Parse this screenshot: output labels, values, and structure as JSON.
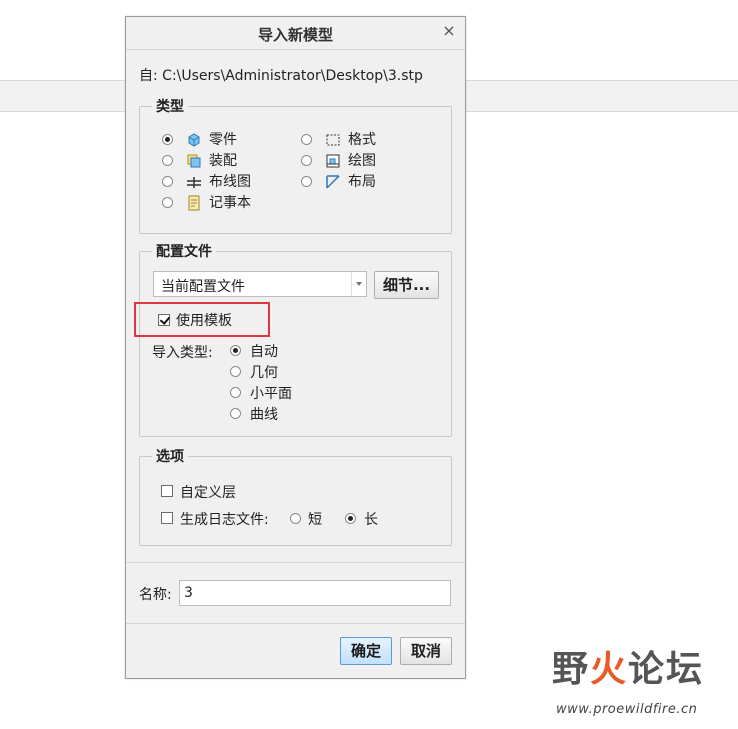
{
  "dialog": {
    "title": "导入新模型",
    "close_glyph": "×",
    "from_text": "自: C:\\Users\\Administrator\\Desktop\\3.stp"
  },
  "type_group": {
    "legend": "类型",
    "options": [
      {
        "label": "零件",
        "icon": "part-icon",
        "checked": true
      },
      {
        "label": "装配",
        "icon": "assembly-icon",
        "checked": false
      },
      {
        "label": "布线图",
        "icon": "diagram-icon",
        "checked": false
      },
      {
        "label": "记事本",
        "icon": "notebook-icon",
        "checked": false
      },
      {
        "label": "格式",
        "icon": "format-icon",
        "checked": false
      },
      {
        "label": "绘图",
        "icon": "drawing-icon",
        "checked": false
      },
      {
        "label": "布局",
        "icon": "layout-icon",
        "checked": false
      }
    ]
  },
  "profile_group": {
    "legend": "配置文件",
    "select_value": "当前配置文件",
    "details_button": "细节...",
    "use_template_label": "使用模板",
    "use_template_checked": true,
    "import_type_label": "导入类型:",
    "import_types": [
      {
        "label": "自动",
        "checked": true
      },
      {
        "label": "几何",
        "checked": false
      },
      {
        "label": "小平面",
        "checked": false
      },
      {
        "label": "曲线",
        "checked": false
      }
    ]
  },
  "options_group": {
    "legend": "选项",
    "custom_layer_label": "自定义层",
    "log_file_label": "生成日志文件:",
    "log_short": "短",
    "log_long": "长",
    "log_selected": "长"
  },
  "name_field": {
    "label": "名称:",
    "value": "3"
  },
  "buttons": {
    "ok": "确定",
    "cancel": "取消"
  },
  "watermark": {
    "text_part1": "野",
    "text_part2": "火",
    "text_part3": "论坛",
    "url": "www.proewildfire.cn"
  },
  "colors": {
    "highlight_box": "#e0373f",
    "primary_button": "#c2e0fb",
    "accent_fire": "#e85a2a"
  }
}
